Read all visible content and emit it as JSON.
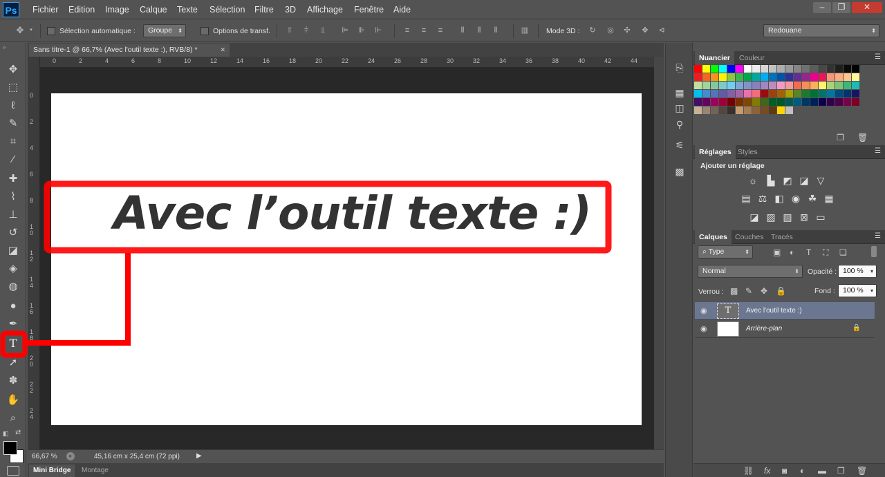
{
  "app": {
    "logo": "Ps"
  },
  "menu": [
    "Fichier",
    "Edition",
    "Image",
    "Calque",
    "Texte",
    "Sélection",
    "Filtre",
    "3D",
    "Affichage",
    "Fenêtre",
    "Aide"
  ],
  "window_controls": {
    "minimize": "–",
    "restore": "❐",
    "close": "✕"
  },
  "options": {
    "auto_select_label": "Sélection automatique :",
    "auto_select_value": "Groupe",
    "transform_label": "Options de transf.",
    "mode3d_label": "Mode 3D :",
    "workspace_value": "Redouane"
  },
  "document": {
    "tab_title": "Sans titre-1 @ 66,7% (Avec l'outil texte :), RVB/8) *",
    "tab_close": "✕",
    "canvas_text": "Avec l’outil texte :)",
    "zoom": "66,67 %",
    "size_info": "45,16 cm x 25,4 cm (72 ppi)"
  },
  "ruler_top": [
    "0",
    "2",
    "4",
    "6",
    "8",
    "10",
    "12",
    "14",
    "16",
    "18",
    "20",
    "22",
    "24",
    "26",
    "28",
    "30",
    "32",
    "34",
    "36",
    "38",
    "40",
    "42",
    "44"
  ],
  "ruler_left": [
    "0",
    "2",
    "4",
    "6",
    "8",
    "1 0",
    "1 2",
    "1 4",
    "1 6",
    "1 8",
    "2 0",
    "2 2",
    "2 4"
  ],
  "bottom_tabs": [
    "Mini Bridge",
    "Montage"
  ],
  "panels": {
    "swatches_tabs": [
      "Nuancier",
      "Couleur"
    ],
    "adjust_tabs": [
      "Réglages",
      "Styles"
    ],
    "adjust_title": "Ajouter un réglage",
    "layers_tabs": [
      "Calques",
      "Couches",
      "Tracés"
    ],
    "filter_value": "Type",
    "blend_value": "Normal",
    "opacity_label": "Opacité :",
    "opacity_value": "100 %",
    "lock_label": "Verrou :",
    "fill_label": "Fond :",
    "fill_value": "100 %"
  },
  "layers": [
    {
      "name": "Avec l'outil texte :)",
      "type": "text",
      "selected": true
    },
    {
      "name": "Arrière-plan",
      "type": "background",
      "selected": false
    }
  ],
  "swatch_colors": [
    [
      "#ff0000",
      "#ffff00",
      "#00ff00",
      "#00ffff",
      "#0000ff",
      "#ff00ff",
      "#ffffff",
      "#ebebeb",
      "#d6d6d6",
      "#c2c2c2",
      "#adadad",
      "#999999",
      "#858585",
      "#707070",
      "#5c5c5c",
      "#474747",
      "#333333",
      "#1f1f1f",
      "#0a0a0a",
      "#000000"
    ],
    [
      "#ed1c24",
      "#f26522",
      "#f7941d",
      "#fff200",
      "#8dc63f",
      "#39b54a",
      "#00a651",
      "#00a99d",
      "#00aeef",
      "#0072bc",
      "#0054a6",
      "#2e3192",
      "#662d91",
      "#92278f",
      "#ec008c",
      "#ed145b",
      "#f7977a",
      "#f9ad81",
      "#fdc68a",
      "#fff79a"
    ],
    [
      "#c4df9b",
      "#a3d39c",
      "#82ca9d",
      "#7accc8",
      "#6dcff6",
      "#7da7d9",
      "#8393ca",
      "#8781bd",
      "#a187be",
      "#bd8cbf",
      "#f49ac2",
      "#f6989d",
      "#f26c4f",
      "#f68e56",
      "#fbaf5d",
      "#fff568",
      "#acd373",
      "#7cc576",
      "#3bb878",
      "#1abbb4"
    ],
    [
      "#00bff3",
      "#448ccb",
      "#5574b9",
      "#605ca8",
      "#8560a8",
      "#a864a8",
      "#f06eaa",
      "#f26d7d",
      "#9e0b0f",
      "#a0410d",
      "#a36209",
      "#aba000",
      "#598527",
      "#197b30",
      "#007236",
      "#00746b",
      "#0076a3",
      "#004b80",
      "#003471",
      "#1b1464"
    ],
    [
      "#440e62",
      "#630460",
      "#9e005d",
      "#9e0039",
      "#790000",
      "#7b2e00",
      "#7d4900",
      "#827b00",
      "#406618",
      "#005e20",
      "#005826",
      "#005952",
      "#005b7f",
      "#003663",
      "#002157",
      "#0d004c",
      "#32004b",
      "#4b0049",
      "#7b0046",
      "#7a0026"
    ],
    [
      "#c7b299",
      "#998675",
      "#736357",
      "#534741",
      "#37302d",
      "#c69c6d",
      "#a67c52",
      "#8c6239",
      "#754c24",
      "#603913",
      "#ffd700",
      "#c0c0c0"
    ]
  ]
}
